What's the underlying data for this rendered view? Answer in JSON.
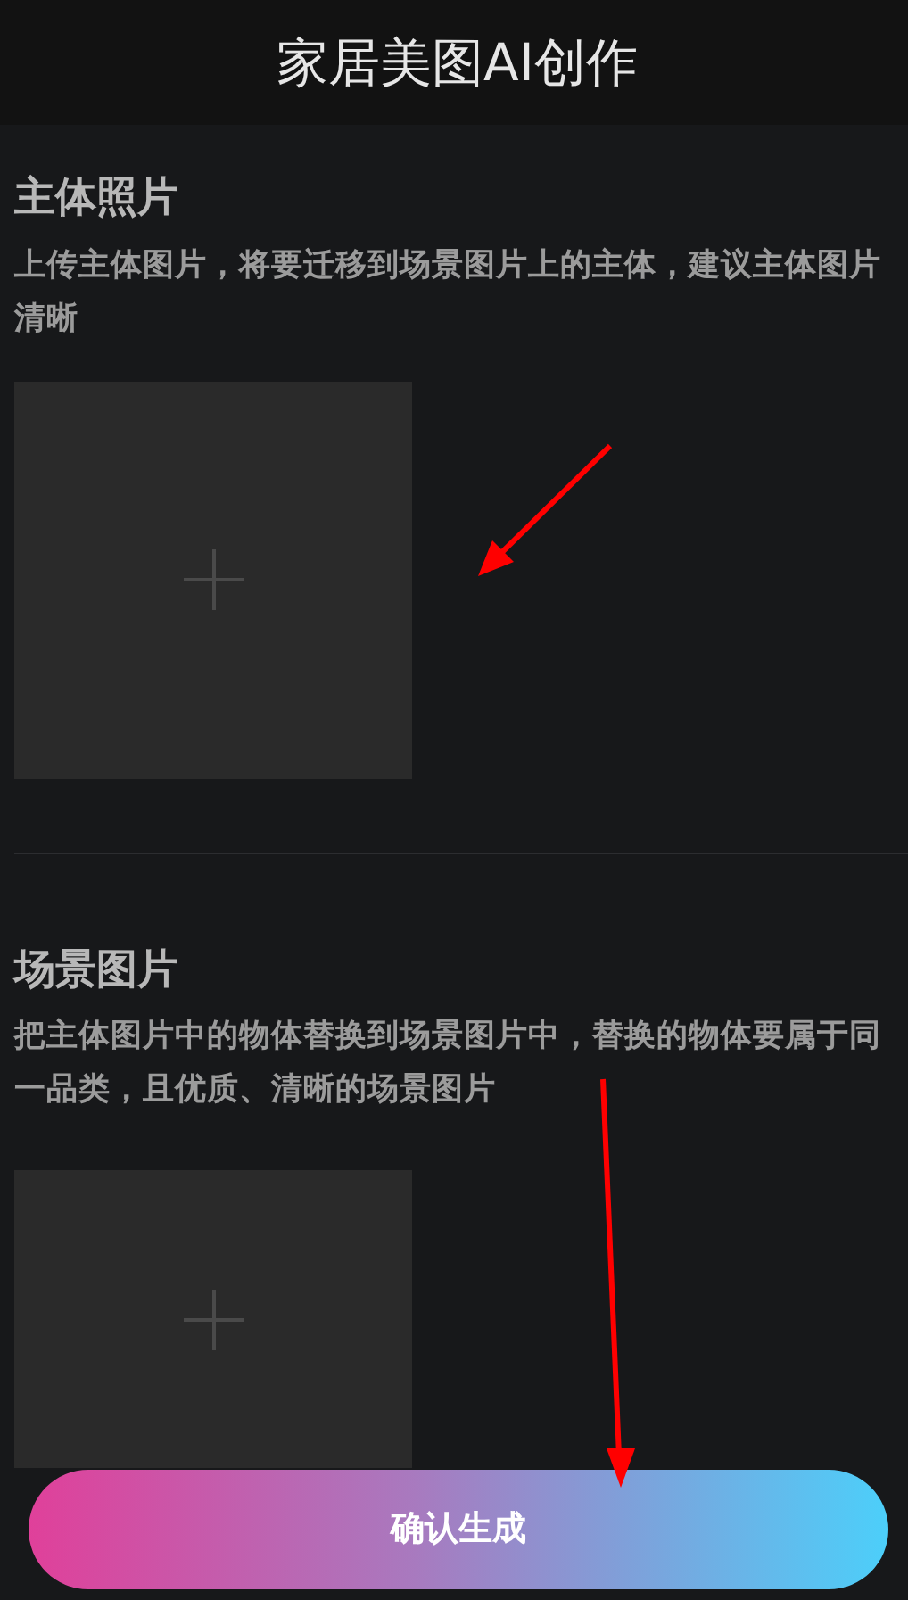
{
  "header": {
    "title": "家居美图AI创作"
  },
  "sections": [
    {
      "title": "主体照片",
      "description": "上传主体图片，将要迁移到场景图片上的主体，建议主体图片清晰",
      "upload": {
        "kind": "empty"
      }
    },
    {
      "title": "场景图片",
      "description": "把主体图片中的物体替换到场景图片中，替换的物体要属于同一品类，且优质、清晰的场景图片",
      "upload": {
        "kind": "empty"
      }
    }
  ],
  "submit_button": {
    "label": "确认生成"
  }
}
